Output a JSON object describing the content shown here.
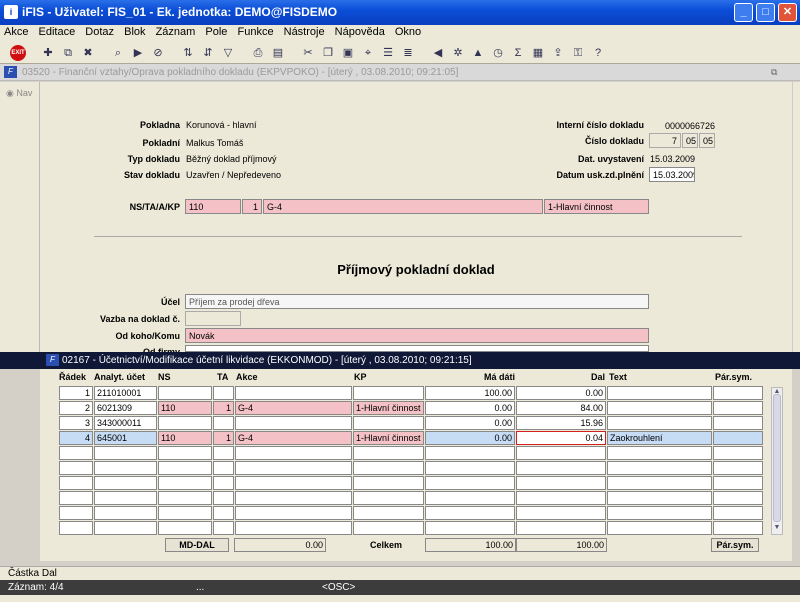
{
  "app": {
    "title": "iFIS - Uživatel: FIS_01 - Ek. jednotka: DEMO@FISDEMO"
  },
  "menu": [
    "Akce",
    "Editace",
    "Dotaz",
    "Blok",
    "Záznam",
    "Pole",
    "Funkce",
    "Nástroje",
    "Nápověda",
    "Okno"
  ],
  "toolbar": {
    "exit_label": "EXIT"
  },
  "window1": {
    "title": "03520 - Finanční vztahy/Oprava pokladního dokladu (EKPVPOKO) - [úterý , 03.08.2010; 09:21:05]",
    "nav_label": "Nav",
    "fields": {
      "pokladna_label": "Pokladna",
      "pokladna_value": "Korunová - hlavní",
      "pokladni_label": "Pokladní",
      "pokladni_value": "Malkus Tomáš",
      "typ_label": "Typ dokladu",
      "typ_value": "Běžný doklad příjmový",
      "stav_label": "Stav dokladu",
      "stav_value": "Uzavřen / Nepředeveno",
      "interni_label": "Interní číslo dokladu",
      "interni_value": "0000066726",
      "cislo_label": "Číslo dokladu",
      "cislo_1": "7",
      "cislo_2": "05",
      "cislo_3": "05",
      "dat_vyst_label": "Dat. uvystavení",
      "dat_vyst_value": "15.03.2009",
      "datum_usk_label": "Datum usk.zd.plnění",
      "datum_usk_value": "15.03.2009",
      "nstaakp_label": "NS/TA/A/KP",
      "ns_value": "110",
      "ta_value": "1",
      "a_value": "G-4",
      "kp_value": "1-Hlavní činnost"
    },
    "heading": "Příjmový pokladní doklad",
    "ucel_label": "Účel",
    "ucel_value": "Příjem za prodej dřeva",
    "vazba_label": "Vazba na doklad č.",
    "vazba_value": "",
    "odkoho_label": "Od koho/Komu",
    "odkoho_value": "Novák",
    "odfirmy_label": "Od firmy"
  },
  "window2": {
    "title": "02167 - Účetnictví/Modifikace účetní likvidace (EKKONMOD) - [úterý , 03.08.2010; 09:21:15]",
    "headers": [
      "Řádek",
      "Analyt. účet",
      "NS",
      "TA",
      "Akce",
      "KP",
      "Má dáti",
      "Dal",
      "Text",
      "Pár.sym."
    ],
    "rows": [
      {
        "radek": "1",
        "ucet": "211010001",
        "ns": "",
        "ta": "",
        "akce": "",
        "kp": "",
        "madati": "100.00",
        "dal": "0.00",
        "text": "",
        "parsym": ""
      },
      {
        "radek": "2",
        "ucet": "6021309",
        "ns": "110",
        "ta": "1",
        "akce": "G-4",
        "kp": "1-Hlavní činnost",
        "madati": "0.00",
        "dal": "84.00",
        "text": "",
        "parsym": ""
      },
      {
        "radek": "3",
        "ucet": "343000011",
        "ns": "",
        "ta": "",
        "akce": "",
        "kp": "",
        "madati": "0.00",
        "dal": "15.96",
        "text": "",
        "parsym": ""
      },
      {
        "radek": "4",
        "ucet": "645001",
        "ns": "110",
        "ta": "1",
        "akce": "G-4",
        "kp": "1-Hlavní činnost",
        "madati": "0.00",
        "dal": "0.04",
        "text": "Zaokrouhlení",
        "parsym": ""
      }
    ],
    "footer": {
      "mddal_label": "MD-DAL",
      "mddal_value": "0.00",
      "celkem_label": "Celkem",
      "celkem_madati": "100.00",
      "celkem_dal": "100.00",
      "parsym_button": "Pár.sym."
    }
  },
  "status": {
    "message": "Částka Dal",
    "record": "Záznam: 4/4",
    "mid": "...",
    "osc": "<OSC>"
  }
}
